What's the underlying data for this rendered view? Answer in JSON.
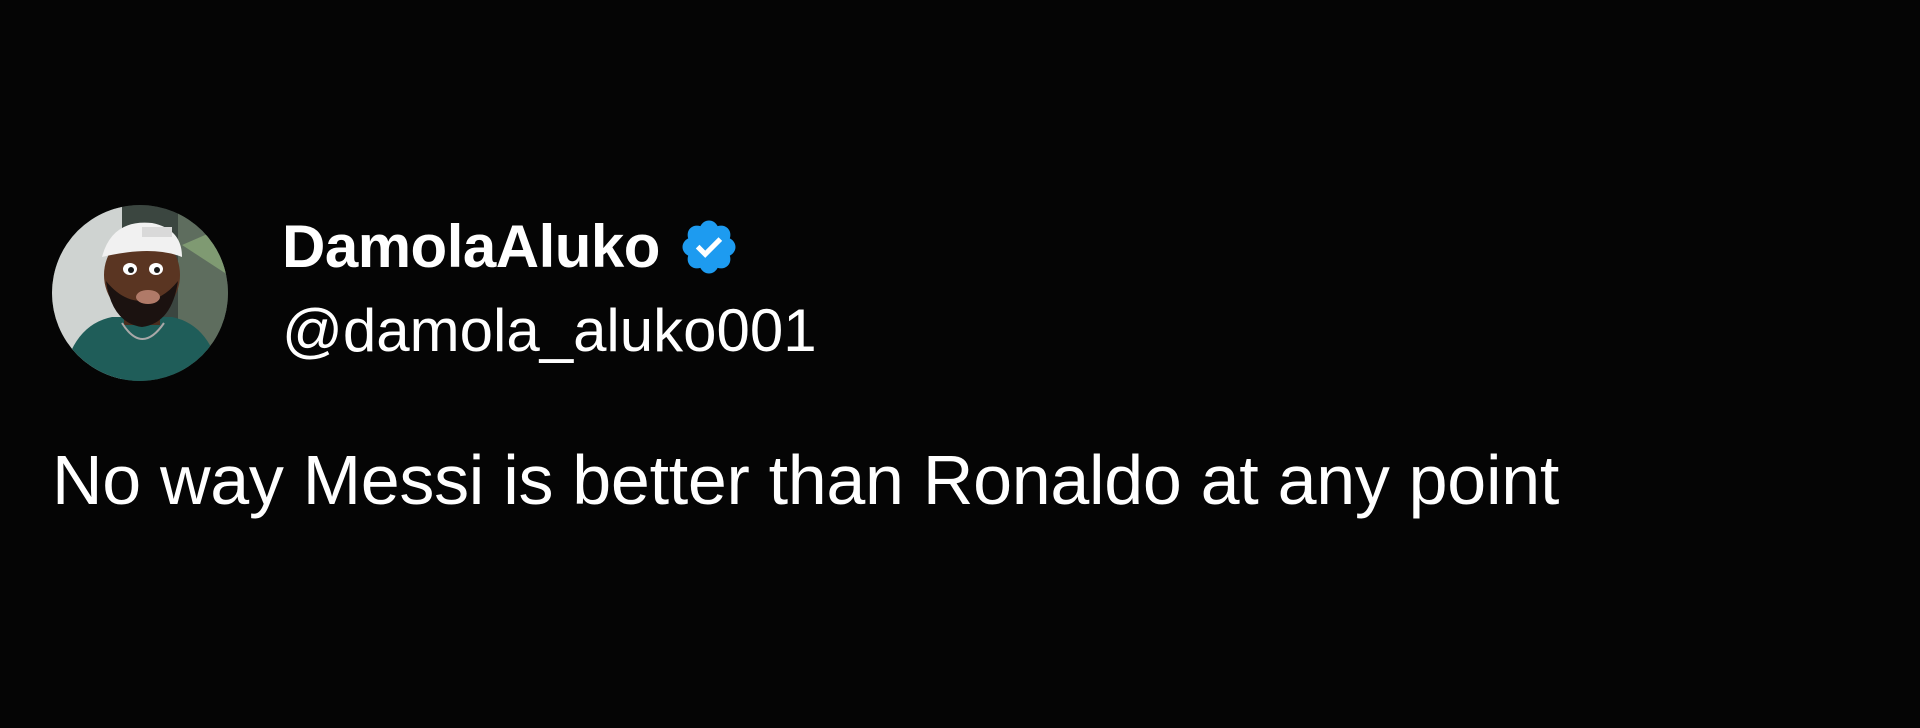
{
  "tweet": {
    "author": {
      "display_name": "DamolaAluko",
      "handle": "@damola_aluko001",
      "verified": true,
      "avatar_icon": "profile-photo",
      "verified_icon": "verified-badge-icon",
      "verified_color": "#1d9bf0"
    },
    "text": "No way Messi is better than Ronaldo at any point"
  },
  "colors": {
    "background": "#050505",
    "text": "#ffffff"
  }
}
